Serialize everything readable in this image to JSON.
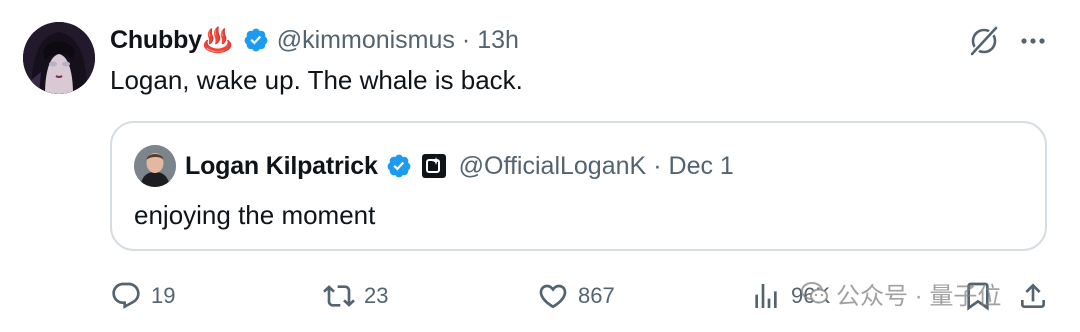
{
  "tweet": {
    "author_name": "Chubby",
    "author_emoji": "♨️",
    "handle": "@kimmonismus",
    "separator": "·",
    "time": "13h",
    "text": "Logan, wake up. The whale is back."
  },
  "quoted_tweet": {
    "author_name": "Logan Kilpatrick",
    "handle": "@OfficialLoganK",
    "separator": "·",
    "date": "Dec 1",
    "text": "enjoying the moment"
  },
  "actions": {
    "replies": "19",
    "reposts": "23",
    "likes": "867",
    "views": "96K"
  },
  "watermark": {
    "text": "公众号 · 量子位"
  },
  "colors": {
    "verified_blue": "#1d9bf0",
    "secondary_text": "#536471",
    "primary_text": "#0f1419",
    "border": "#d5dce2"
  }
}
